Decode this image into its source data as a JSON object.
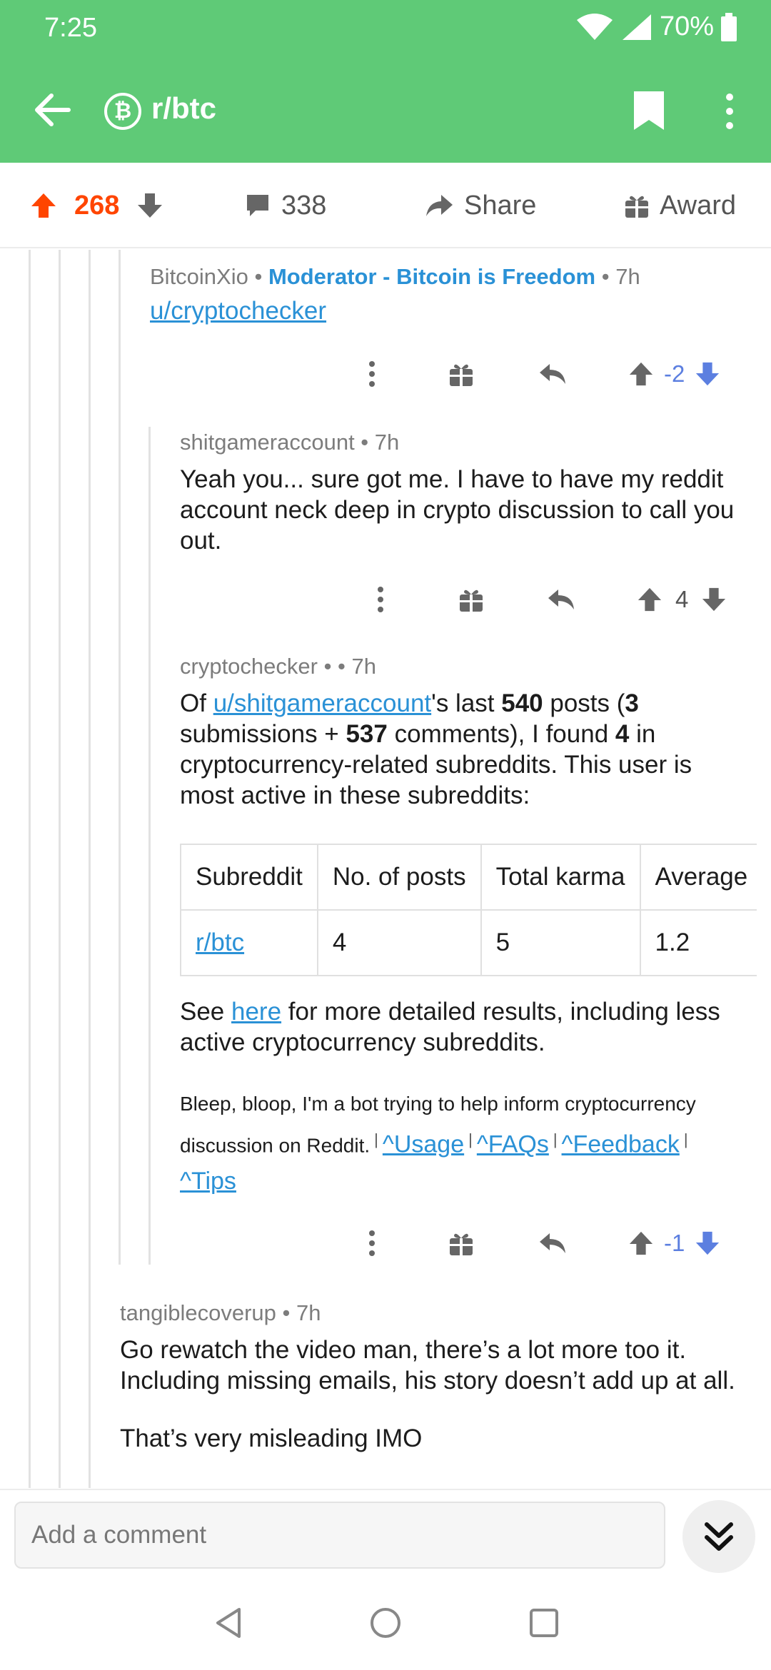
{
  "status_bar": {
    "time": "7:25",
    "battery": "70%"
  },
  "toolbar": {
    "subreddit": "r/btc",
    "sub_icon_glyph": "₿"
  },
  "post_actions": {
    "score": "268",
    "comments": "338",
    "share": "Share",
    "award": "Award"
  },
  "comments": [
    {
      "author": "BitcoinXio",
      "flair": "Moderator - Bitcoin is Freedom",
      "age": "7h",
      "link_text": "u/cryptochecker",
      "score": "-2"
    },
    {
      "author": "shitgameraccount",
      "age": "7h",
      "body": "Yeah you... sure got me. I have to have my reddit account neck deep in crypto discussion to call you out.",
      "score": "4"
    },
    {
      "author": "cryptochecker",
      "age": "7h",
      "body_parts": {
        "p1_prefix": "Of ",
        "p1_user": "u/shitgameraccount",
        "p1_a": "'s last ",
        "p1_posts": "540",
        "p1_b": " posts (",
        "p1_subs": "3",
        "p1_c": " submissions + ",
        "p1_comments": "537",
        "p1_d": " comments), I found ",
        "p1_found": "4",
        "p1_e": " in cryptocurrency-related subreddits. This user is most active in these subreddits:"
      },
      "table": {
        "headers": [
          "Subreddit",
          "No. of posts",
          "Total karma",
          "Average"
        ],
        "rows": [
          [
            "r/btc",
            "4",
            "5",
            "1.2"
          ]
        ]
      },
      "p2_a": "See ",
      "p2_link": "here",
      "p2_b": " for more detailed results, including less active cryptocurrency subreddits.",
      "footer_text": "Bleep, bloop, I'm a bot trying to help inform cryptocurrency discussion on Reddit.",
      "footer_links": [
        "^Usage",
        "^FAQs",
        "^Feedback",
        "^Tips"
      ],
      "score": "-1"
    },
    {
      "author": "tangiblecoverup",
      "age": "7h",
      "body": "Go rewatch the video man, there’s a lot more too it. Including missing emails, his story doesn’t add up at all.",
      "body2": "That’s very misleading IMO"
    }
  ],
  "composer": {
    "placeholder": "Add a comment"
  },
  "colors": {
    "header": "#5fca77",
    "upvote": "#ff4500",
    "downvote_blue": "#5c7fe0",
    "link": "#2a91d6"
  },
  "icons": [
    "back-arrow-icon",
    "bitcoin-icon",
    "bookmark-icon",
    "more-vert-icon",
    "upvote-icon",
    "downvote-icon",
    "comment-icon",
    "share-icon",
    "gift-icon",
    "reply-icon",
    "double-chevron-down-icon",
    "nav-back-icon",
    "nav-home-icon",
    "nav-recents-icon",
    "wifi-icon",
    "signal-icon",
    "battery-icon"
  ]
}
